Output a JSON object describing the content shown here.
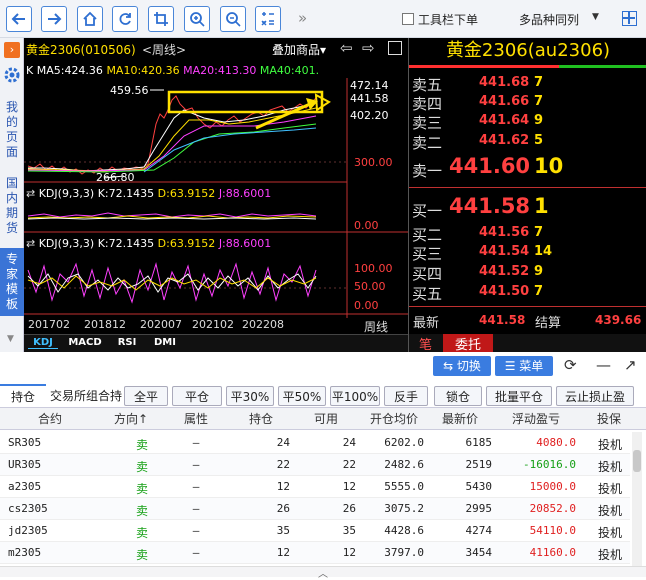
{
  "toolbar": {
    "more_glyph": "»",
    "toolbar_dock_label": "工具栏下单",
    "multi_symbol_label": "多品种同列"
  },
  "sidebar": {
    "items": [
      "我的页面",
      "国内期货",
      "专家模板"
    ]
  },
  "chart_header": {
    "title": "黄金2306(010506)",
    "period": "<周线>",
    "overlay_label": "叠加商品▾"
  },
  "ma_line": {
    "k": "K",
    "ma5": "MA5:424.36",
    "ma10": "MA10:420.36",
    "ma20": "MA20:413.30",
    "ma40": "MA40:401."
  },
  "price_axis": [
    "472.14",
    "441.58",
    "402.20",
    "300.00"
  ],
  "price_labels": {
    "high": "459.56",
    "low": "266.80"
  },
  "kdj1": {
    "label": "KDJ(9,3,3)",
    "k": "K:72.1435",
    "d": "D:63.9152",
    "j": "J:88.6001",
    "axis": "0.00"
  },
  "kdj2": {
    "label": "KDJ(9,3,3)",
    "k": "K:72.1435",
    "d": "D:63.9152",
    "j": "J:88.6001",
    "axis": [
      "100.00",
      "50.00",
      "0.00"
    ]
  },
  "date_axis": [
    "201702",
    "201812",
    "202007",
    "202102",
    "202208"
  ],
  "period_label": "周线",
  "indicator_tabs": [
    "KDJ",
    "MACD",
    "RSI",
    "DMI"
  ],
  "quote": {
    "title": "黄金2306(au2306)",
    "asks": [
      {
        "label": "卖五",
        "price": "441.68",
        "vol": "7"
      },
      {
        "label": "卖四",
        "price": "441.66",
        "vol": "7"
      },
      {
        "label": "卖三",
        "price": "441.64",
        "vol": "9"
      },
      {
        "label": "卖二",
        "price": "441.62",
        "vol": "5"
      },
      {
        "label": "卖一",
        "price": "441.60",
        "vol": "10"
      }
    ],
    "bids": [
      {
        "label": "买一",
        "price": "441.58",
        "vol": "1"
      },
      {
        "label": "买二",
        "price": "441.56",
        "vol": "7"
      },
      {
        "label": "买三",
        "price": "441.54",
        "vol": "14"
      },
      {
        "label": "买四",
        "price": "441.52",
        "vol": "9"
      },
      {
        "label": "买五",
        "price": "441.50",
        "vol": "7"
      }
    ],
    "last_label": "最新",
    "last_value": "441.58",
    "settle_label": "结算",
    "settle_value": "439.66",
    "tab_pen": "笔",
    "tab_order": "委托"
  },
  "panel_buttons": {
    "switch": "⇆ 切换",
    "menu": "☰ 菜单"
  },
  "bottom": {
    "tabs": [
      "持仓",
      "交易所组合持"
    ],
    "actions": [
      "全平",
      "平仓",
      "平30%",
      "平50%",
      "平100%",
      "反手",
      "锁仓",
      "批量平仓",
      "云止损止盈"
    ],
    "columns": [
      "合约",
      "方向↑",
      "属性",
      "持仓",
      "可用",
      "开仓均价",
      "最新价",
      "浮动盈亏",
      "投保"
    ],
    "rows": [
      {
        "contract": "SR305",
        "dir": "卖",
        "attr": "—",
        "pos": "24",
        "avail": "24",
        "open": "6202.0",
        "last": "6185",
        "pnl": "4080.0",
        "hedge": "投机",
        "pnl_color": "#e02020"
      },
      {
        "contract": "UR305",
        "dir": "卖",
        "attr": "—",
        "pos": "22",
        "avail": "22",
        "open": "2482.6",
        "last": "2519",
        "pnl": "-16016.0",
        "hedge": "投机",
        "pnl_color": "#16a016"
      },
      {
        "contract": "a2305",
        "dir": "卖",
        "attr": "—",
        "pos": "12",
        "avail": "12",
        "open": "5555.0",
        "last": "5430",
        "pnl": "15000.0",
        "hedge": "投机",
        "pnl_color": "#e02020"
      },
      {
        "contract": "cs2305",
        "dir": "卖",
        "attr": "—",
        "pos": "26",
        "avail": "26",
        "open": "3075.2",
        "last": "2995",
        "pnl": "20852.0",
        "hedge": "投机",
        "pnl_color": "#e02020"
      },
      {
        "contract": "jd2305",
        "dir": "卖",
        "attr": "—",
        "pos": "35",
        "avail": "35",
        "open": "4428.6",
        "last": "4274",
        "pnl": "54110.0",
        "hedge": "投机",
        "pnl_color": "#e02020"
      },
      {
        "contract": "m2305",
        "dir": "卖",
        "attr": "—",
        "pos": "12",
        "avail": "12",
        "open": "3797.0",
        "last": "3454",
        "pnl": "41160.0",
        "hedge": "投机",
        "pnl_color": "#e02020"
      }
    ]
  },
  "colors": {
    "up": "#ff4040",
    "vol": "#ffe000",
    "ma5": "#ffffff",
    "ma10": "#ffe000",
    "ma20": "#ff40ff",
    "ma40": "#40ff40"
  }
}
